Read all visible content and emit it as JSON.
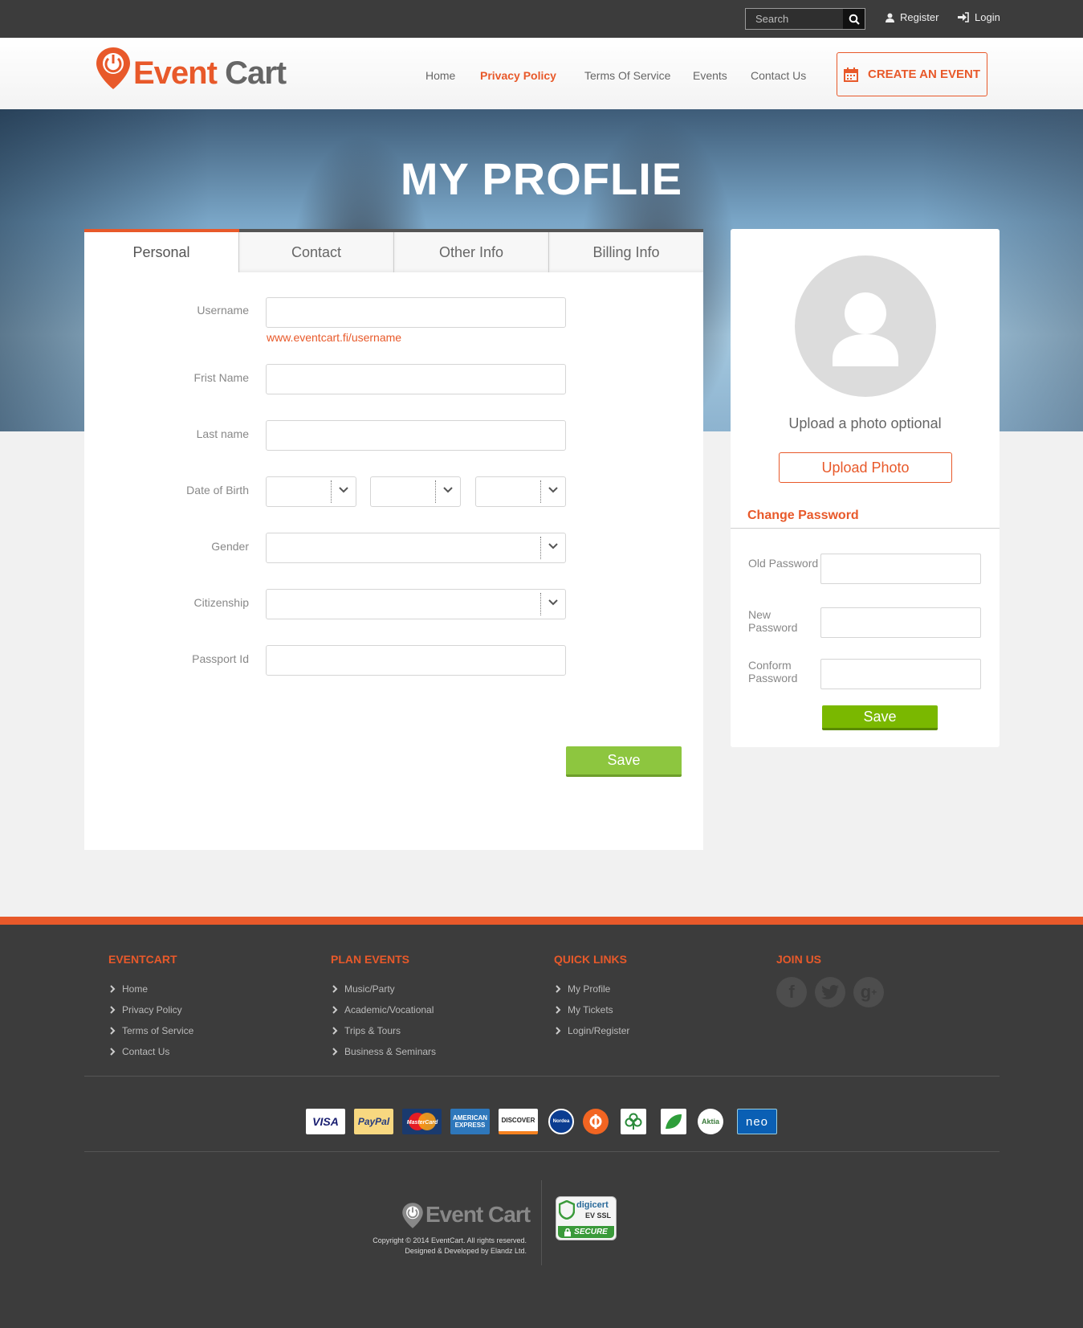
{
  "topbar": {
    "search_placeholder": "Search",
    "register_label": "Register",
    "login_label": "Login"
  },
  "header": {
    "logo_event": "Event",
    "logo_cart": "Cart",
    "nav": [
      "Home",
      "Privacy Policy",
      "Terms Of Service",
      "Events",
      "Contact Us"
    ],
    "nav_active": "Privacy Policy",
    "cta_label": "CREATE AN EVENT"
  },
  "hero": {
    "title": "MY PROFLIE"
  },
  "tabs": [
    "Personal",
    "Contact",
    "Other Info",
    "Billing Info"
  ],
  "tab_active": "Personal",
  "form": {
    "username_label": "Username",
    "username_hint": "www.eventcart.fi/username",
    "first_name_label": "Frist Name",
    "last_name_label": "Last name",
    "dob_label": "Date of Birth",
    "gender_label": "Gender",
    "citizenship_label": "Citizenship",
    "passport_label": "Passport Id",
    "save_label": "Save"
  },
  "sidebar": {
    "upload_text": "Upload a photo optional",
    "upload_button": "Upload Photo",
    "change_password_title": "Change Password",
    "old_password_label": "Old Password",
    "new_password_label": "New Password",
    "confirm_password_label": "Conform Password",
    "save_label": "Save"
  },
  "footer": {
    "columns": [
      {
        "title": "EVENTCART",
        "items": [
          "Home",
          "Privacy Policy",
          "Terms of Service",
          "Contact Us"
        ]
      },
      {
        "title": "PLAN EVENTS",
        "items": [
          "Music/Party",
          "Academic/Vocational",
          "Trips & Tours",
          "Business & Seminars"
        ]
      },
      {
        "title": "QUICK LINKS",
        "items": [
          "My Profile",
          "My Tickets",
          "Login/Register"
        ]
      }
    ],
    "join_title": "JOIN US",
    "social": [
      "facebook-icon",
      "twitter-icon",
      "google-plus-icon"
    ],
    "payments": {
      "visa": "VISA",
      "paypal": "PayPal",
      "mastercard": "MasterCard",
      "amex": "AMERICAN EXPRESS",
      "discover": "DISCOVER",
      "nordea": "Nordea",
      "aktia": "Aktia",
      "neo": "neo"
    },
    "logo_text": "Event Cart",
    "copyright": "Copyright © 2014 EventCart. All rights reserved.",
    "designed_by": "Designed & Developed by Elandz Ltd.",
    "ssl_brand": "digicert",
    "ssl_type": "EV SSL",
    "ssl_secure": "SECURE"
  },
  "colors": {
    "accent": "#e8592a",
    "green": "#8dc63f",
    "dark": "#3c3c3c"
  }
}
